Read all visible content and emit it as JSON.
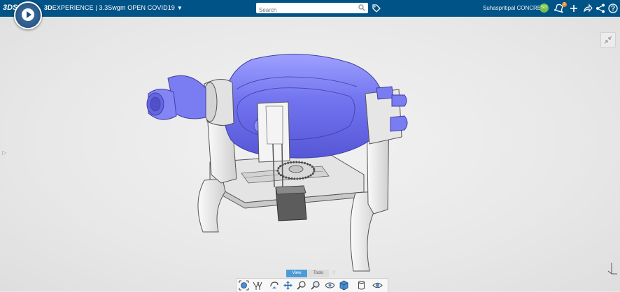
{
  "topbar": {
    "logo_text": "3DS",
    "app_brand": "3D",
    "app_title": "EXPERIENCE | 3.3Swgm  OPEN COVID19",
    "search_placeholder": "Search",
    "user_name": "Suhaspritipal CONCRETE",
    "user_initials": "SG",
    "notification_count": "2",
    "icons": [
      "tag-icon",
      "notification-icon",
      "add-icon",
      "share-icon",
      "share-network-icon",
      "help-icon"
    ],
    "bg_color": "#005386"
  },
  "viewer": {
    "model": "ventilator bag assembly",
    "accent_color": "#7a7cf2"
  },
  "action_bar": {
    "tabs": [
      {
        "label": "View",
        "active": true
      },
      {
        "label": "Tools",
        "active": false
      }
    ],
    "tools": [
      "fit-all-icon",
      "pan-rotate-icon",
      "rotate-icon",
      "pan-icon",
      "zoom-area-icon",
      "zoom-icon",
      "look-at-icon",
      "view-cube-icon",
      "cylinder-icon",
      "visibility-icon"
    ]
  }
}
